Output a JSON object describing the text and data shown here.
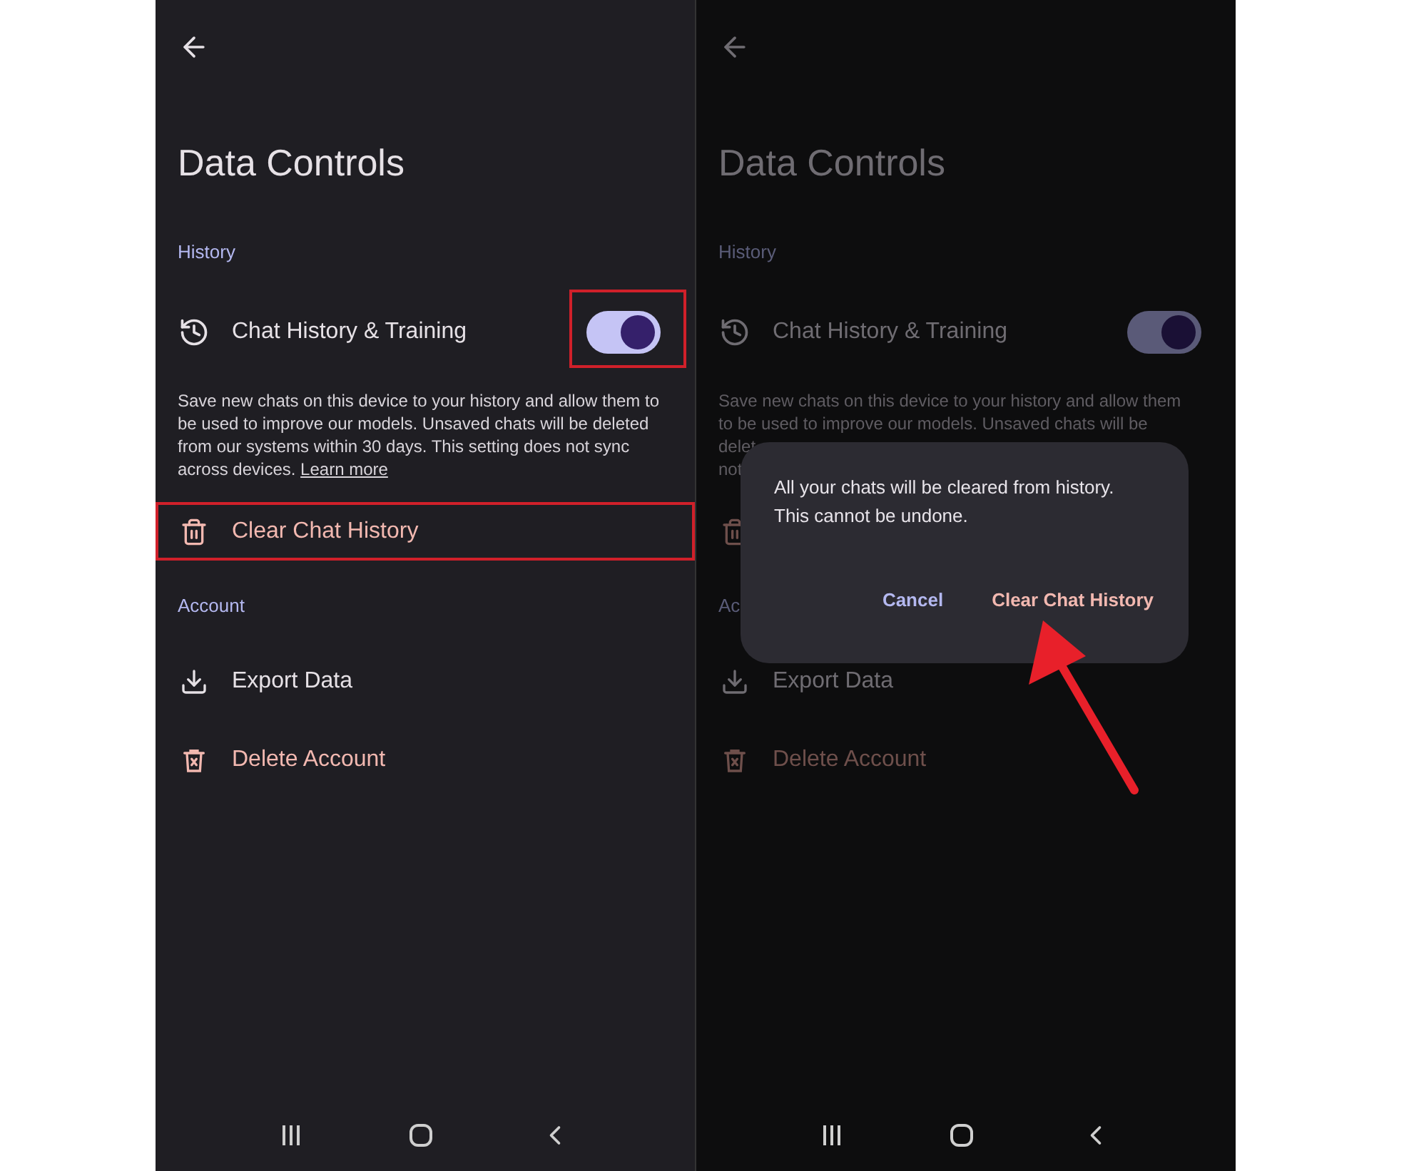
{
  "screens": [
    {
      "dimmed": false,
      "title": "Data Controls",
      "sections": [
        {
          "label": "History",
          "items": [
            {
              "kind": "toggle",
              "label": "Chat History & Training",
              "on": true,
              "highlighted": true
            },
            {
              "kind": "note",
              "text": "Save new chats on this device to your history and allow them to be used to improve our models. Unsaved chats will be deleted from our systems within 30 days. This setting does not sync across devices.",
              "link": "Learn more"
            },
            {
              "kind": "destructive",
              "label": "Clear Chat History",
              "highlighted": true
            }
          ]
        },
        {
          "label": "Account",
          "items": [
            {
              "kind": "plain",
              "label": "Export Data"
            },
            {
              "kind": "destructive",
              "label": "Delete Account"
            }
          ]
        }
      ]
    },
    {
      "dimmed": true,
      "title": "Data Controls",
      "sections": [
        {
          "label": "History",
          "items": [
            {
              "kind": "toggle",
              "label": "Chat History & Training",
              "on": true,
              "highlighted": false
            },
            {
              "kind": "note",
              "lines": [
                "Save new chats on this device to your history and allow them",
                "to be used to improve our models. Unsaved chats will be",
                "delet",
                "not"
              ]
            },
            {
              "kind": "destructive",
              "highlighted": false
            }
          ]
        },
        {
          "label": "Ac",
          "items": [
            {
              "kind": "plain",
              "label": "Export Data"
            },
            {
              "kind": "destructive",
              "label": "Delete Account"
            }
          ]
        }
      ],
      "dialog": {
        "message": "All your chats will be cleared from history. This cannot be undone.",
        "pointer_arrow": true,
        "buttons": [
          {
            "label": "Cancel",
            "kind": "neutral"
          },
          {
            "label": "Clear Chat History",
            "kind": "destructive"
          }
        ]
      }
    }
  ]
}
